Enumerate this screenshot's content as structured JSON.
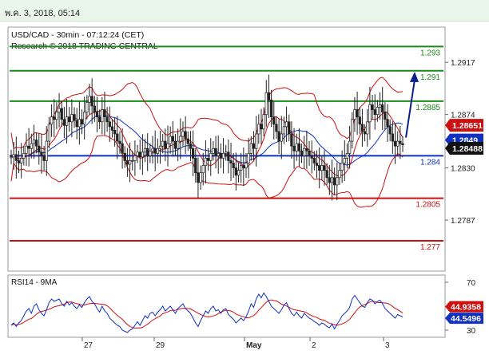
{
  "header": {
    "timestamp": "พ.ค. 3, 2018, 05:14"
  },
  "chart_data": [
    {
      "type": "candlestick",
      "title": "USD/CAD - 30min - 07:12:24 (CET)",
      "subtitle": "Research © 2018 TRADING CENTRAL",
      "ylim": [
        1.2745,
        1.2946
      ],
      "y_ticks": [
        "1.2917",
        "1.2874",
        "1.2830",
        "1.2787"
      ],
      "x_ticks": [
        "27",
        "29",
        "May",
        "2",
        "3"
      ],
      "levels": [
        {
          "label": "1.293",
          "value": 1.293,
          "color": "#1a8a1a"
        },
        {
          "label": "1.291",
          "value": 1.291,
          "color": "#1a8a1a"
        },
        {
          "label": "1.2885",
          "value": 1.2885,
          "color": "#1a8a1a"
        },
        {
          "label": "1.284",
          "value": 1.284,
          "color": "#1030c0"
        },
        {
          "label": "1.2805",
          "value": 1.2805,
          "color": "#cc1010"
        },
        {
          "label": "1.277",
          "value": 1.277,
          "color": "#cc1010"
        }
      ],
      "price_tags": [
        {
          "label": "1.28651",
          "value": 1.28651,
          "color": "#cc1010"
        },
        {
          "label": "1.2849",
          "value": 1.2849,
          "color": "#1030c0"
        },
        {
          "label": "1.28488",
          "value": 1.28488,
          "color": "#111111"
        }
      ],
      "close": [
        1.2839,
        1.2841,
        1.2836,
        1.2834,
        1.2838,
        1.2842,
        1.2848,
        1.2846,
        1.285,
        1.2853,
        1.2848,
        1.2843,
        1.284,
        1.2836,
        1.2852,
        1.2866,
        1.2872,
        1.287,
        1.2876,
        1.2879,
        1.287,
        1.2865,
        1.2872,
        1.2868,
        1.2874,
        1.2869,
        1.2864,
        1.287,
        1.2866,
        1.2876,
        1.2884,
        1.2889,
        1.2881,
        1.2876,
        1.2872,
        1.2868,
        1.2878,
        1.2872,
        1.2868,
        1.2864,
        1.2861,
        1.2858,
        1.2852,
        1.285,
        1.2842,
        1.2836,
        1.2833,
        1.2836,
        1.2836,
        1.284,
        1.2843,
        1.2839,
        1.2843,
        1.2846,
        1.284,
        1.2844,
        1.2846,
        1.2842,
        1.2846,
        1.2848,
        1.2852,
        1.2846,
        1.285,
        1.2856,
        1.2852,
        1.2846,
        1.2852,
        1.2856,
        1.286,
        1.2854,
        1.285,
        1.2846,
        1.2838,
        1.2826,
        1.2818,
        1.2826,
        1.2832,
        1.2838,
        1.2836,
        1.2842,
        1.2846,
        1.284,
        1.2842,
        1.2838,
        1.2842,
        1.2843,
        1.2836,
        1.2834,
        1.283,
        1.2824,
        1.2828,
        1.2832,
        1.283,
        1.2834,
        1.2842,
        1.285,
        1.2846,
        1.2858,
        1.2866,
        1.2862,
        1.2874,
        1.2892,
        1.2886,
        1.2872,
        1.2866,
        1.286,
        1.2852,
        1.2858,
        1.2864,
        1.2868,
        1.2858,
        1.2848,
        1.2844,
        1.285,
        1.2844,
        1.284,
        1.2846,
        1.2844,
        1.284,
        1.2838,
        1.2834,
        1.2832,
        1.2828,
        1.2832,
        1.2828,
        1.2822,
        1.2818,
        1.2822,
        1.2816,
        1.2822,
        1.2828,
        1.2834,
        1.2838,
        1.2842,
        1.2852,
        1.287,
        1.2878,
        1.2872,
        1.2866,
        1.286,
        1.2858,
        1.2868,
        1.2882,
        1.2878,
        1.2874,
        1.288,
        1.2882,
        1.2876,
        1.287,
        1.2864,
        1.2858,
        1.2852,
        1.2848,
        1.2852,
        1.285,
        1.2849
      ],
      "indicator": {
        "label": "RSI14 - 9MA",
        "ylim": [
          24,
          76
        ],
        "y_ticks": [
          "70",
          "30"
        ],
        "tags": [
          {
            "label": "44.9358",
            "value": 44.9358,
            "color": "#cc1010"
          },
          {
            "label": "44.5496",
            "value": 44.5496,
            "color": "#1030c0"
          }
        ],
        "rsi": [
          34,
          36,
          33,
          36,
          38,
          42,
          46,
          48,
          44,
          50,
          52,
          47,
          44,
          42,
          47,
          53,
          56,
          54,
          55,
          56,
          52,
          50,
          54,
          51,
          53,
          50,
          48,
          51,
          49,
          53,
          56,
          58,
          54,
          52,
          48,
          45,
          50,
          46,
          44,
          40,
          38,
          36,
          34,
          33,
          30,
          29,
          28,
          30,
          31,
          34,
          37,
          34,
          38,
          42,
          40,
          44,
          45,
          42,
          45,
          47,
          50,
          46,
          48,
          50,
          47,
          44,
          48,
          50,
          52,
          48,
          46,
          44,
          40,
          36,
          33,
          38,
          42,
          46,
          44,
          48,
          50,
          46,
          47,
          44,
          47,
          48,
          43,
          41,
          39,
          36,
          38,
          40,
          38,
          41,
          46,
          52,
          49,
          56,
          60,
          57,
          61,
          58,
          54,
          50,
          48,
          46,
          44,
          47,
          51,
          53,
          48,
          44,
          42,
          45,
          42,
          40,
          44,
          42,
          40,
          39,
          37,
          36,
          34,
          36,
          35,
          33,
          32,
          35,
          31,
          35,
          38,
          42,
          44,
          46,
          49,
          56,
          59,
          56,
          53,
          50,
          49,
          53,
          56,
          55,
          52,
          54,
          55,
          52,
          48,
          46,
          44,
          42,
          40,
          43,
          42,
          41
        ]
      }
    }
  ]
}
